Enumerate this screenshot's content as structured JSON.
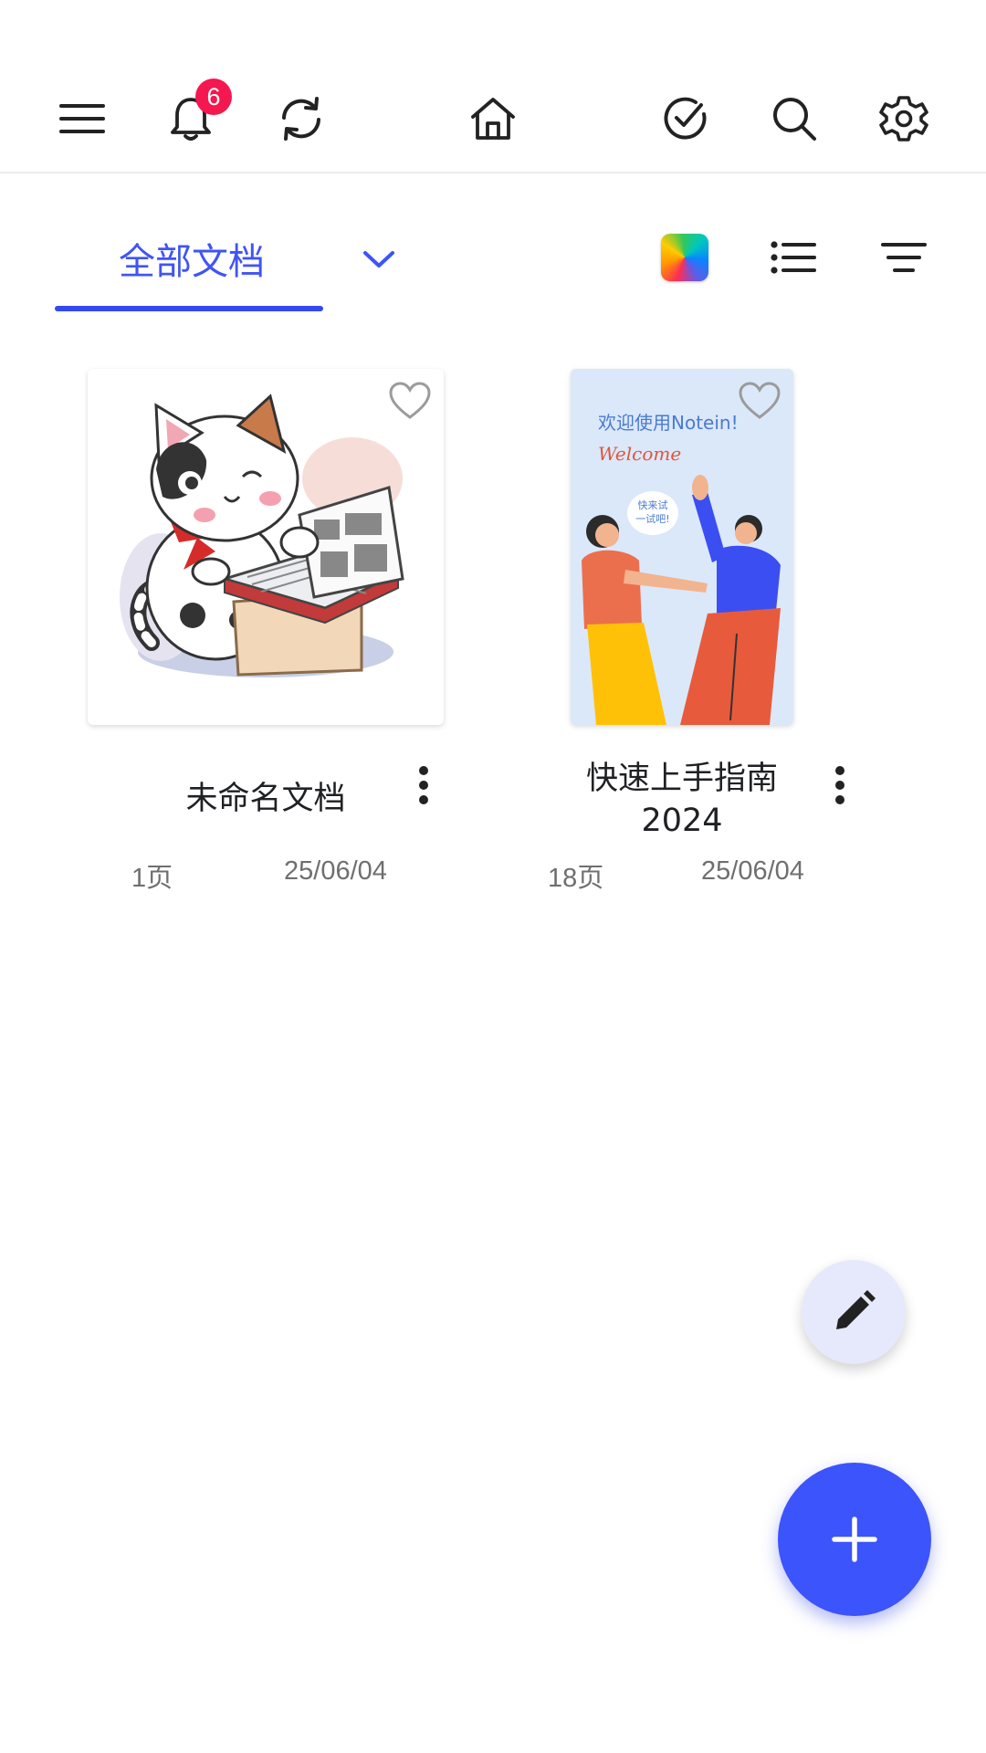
{
  "toolbar": {
    "notification_count": "6",
    "icons": [
      "menu-icon",
      "bell-icon",
      "sync-icon",
      "home-icon",
      "check-circle-icon",
      "search-icon",
      "settings-icon"
    ]
  },
  "tabs": {
    "active_label": "全部文档",
    "accent_color": "#3c54fb"
  },
  "documents": [
    {
      "title": "未命名文档",
      "pages": "1页",
      "date": "25/06/04"
    },
    {
      "title_line1": "快速上手指南",
      "title_line2": "2024",
      "pages": "18页",
      "date": "25/06/04",
      "cover_heading": "欢迎使用Notein!",
      "cover_subheading": "Welcome",
      "cover_bubble_line1": "快来试",
      "cover_bubble_line2": "一试吧!"
    }
  ]
}
